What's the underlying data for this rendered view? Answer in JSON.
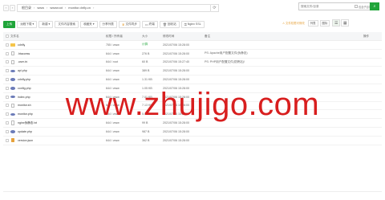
{
  "pathbar": {
    "back_icon": "chevron-left-icon",
    "forward_icon": "chevron-right-icon",
    "crumbs": [
      "根目录",
      "www",
      "wwwroot",
      "monitor.dnfly.cn"
    ],
    "refresh_icon": "refresh-icon",
    "search_placeholder": "搜索文件/目录",
    "search_option": "包含子目录",
    "search_icon": "search-icon"
  },
  "toolbar": {
    "upload": "上传",
    "remote_download": "远程下载",
    "new": "新建",
    "dir_size": "文件内容搜索",
    "favorites": "收藏夹",
    "share_list": "分享列表",
    "vip": "文件同步",
    "terminal": "终端",
    "recycle": "回收站",
    "ssl": "Nginx SSL",
    "hint": "文件权限可修改",
    "view_list": "列表",
    "view_icons": "图标"
  },
  "table": {
    "headers": {
      "name": "文件名",
      "perm": "权限 / 所有者",
      "size": "大小",
      "mtime": "修改时间",
      "note": "备注",
      "action": "操作"
    },
    "rows": [
      {
        "icon": "folder-icon",
        "name": "cdnfly",
        "perm": "755 / www",
        "size": "计算",
        "mtime": "2021/07/06 15:28:00",
        "note": ""
      },
      {
        "icon": "file-icon",
        "name": ".htaccess",
        "perm": "644 / www",
        "size": "276 B",
        "mtime": "2021/07/06 15:28:00",
        "note": "PS: Apache用户配置文件(伪静态)"
      },
      {
        "icon": "file-icon",
        "name": ".user.ini",
        "perm": "644 / root",
        "size": "60 B",
        "mtime": "2021/07/06 15:27:40",
        "note": "PS: PHP用户配置文件(防跨站)!"
      },
      {
        "icon": "php-icon",
        "name": "api.php",
        "perm": "644 / www",
        "size": "389 B",
        "mtime": "2021/07/06 15:28:00",
        "note": ""
      },
      {
        "icon": "php-icon",
        "name": "cdnfly.php",
        "perm": "644 / www",
        "size": "1.31 KB",
        "mtime": "2021/07/06 15:28:00",
        "note": ""
      },
      {
        "icon": "php-icon",
        "name": "config.php",
        "perm": "644 / www",
        "size": "1.05 KB",
        "mtime": "2021/07/06 15:28:00",
        "note": ""
      },
      {
        "icon": "php-icon",
        "name": "index.php",
        "perm": "644 / www",
        "size": "7.01 KB",
        "mtime": "2021/07/06 15:28:00",
        "note": ""
      },
      {
        "icon": "file-icon",
        "name": "monitor.sh",
        "perm": "644 / www",
        "size": "7.13 KB",
        "mtime": "2021/07/06 15:28:00",
        "note": ""
      },
      {
        "icon": "php-icon",
        "name": "monitor.php",
        "perm": "644 / www",
        "size": "5.05 KB",
        "mtime": "2021/07/06 15:28:00",
        "note": ""
      },
      {
        "icon": "file-icon",
        "name": "nginx伪静态.txt",
        "perm": "644 / www",
        "size": "99 B",
        "mtime": "2021/07/06 15:28:00",
        "note": ""
      },
      {
        "icon": "php-icon",
        "name": "update.php",
        "perm": "644 / www",
        "size": "987 B",
        "mtime": "2021/07/06 15:28:00",
        "note": ""
      },
      {
        "icon": "json-icon",
        "name": "version.json",
        "perm": "644 / www",
        "size": "362 B",
        "mtime": "2021/07/06 15:28:00",
        "note": ""
      }
    ]
  },
  "watermark": "www.zhujigo.com",
  "colors": {
    "accent": "#20a53a",
    "watermark": "#d81e1e",
    "folder": "#f5c54a",
    "php": "#6b7bb8"
  }
}
